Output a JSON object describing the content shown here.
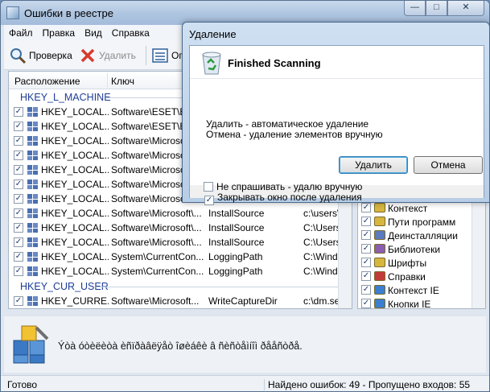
{
  "window": {
    "title": "Ошибки в реестре"
  },
  "menu": [
    "Файл",
    "Правка",
    "Вид",
    "Справка"
  ],
  "toolbar": {
    "check_label": "Проверка",
    "delete_label": "Удалить",
    "options_label": "Оп"
  },
  "list": {
    "columns": [
      "Расположение",
      "Ключ"
    ],
    "group1": "HKEY_L_MACHINE",
    "group2": "HKEY_CUR_USER",
    "rows": [
      {
        "loc": "HKEY_LOCAL...",
        "key": "Software\\ESET\\ESI",
        "val": "",
        "data": ""
      },
      {
        "loc": "HKEY_LOCAL...",
        "key": "Software\\ESET\\ESI",
        "val": "",
        "data": ""
      },
      {
        "loc": "HKEY_LOCAL...",
        "key": "Software\\Microsof",
        "val": "",
        "data": ""
      },
      {
        "loc": "HKEY_LOCAL...",
        "key": "Software\\Microsof",
        "val": "",
        "data": ""
      },
      {
        "loc": "HKEY_LOCAL...",
        "key": "Software\\Microsof",
        "val": "",
        "data": ""
      },
      {
        "loc": "HKEY_LOCAL...",
        "key": "Software\\Microsof",
        "val": "",
        "data": ""
      },
      {
        "loc": "HKEY_LOCAL...",
        "key": "Software\\Microsof",
        "val": "",
        "data": ""
      },
      {
        "loc": "HKEY_LOCAL...",
        "key": "Software\\Microsoft\\...",
        "val": "InstallSource",
        "data": "c:\\users\\"
      },
      {
        "loc": "HKEY_LOCAL...",
        "key": "Software\\Microsoft\\...",
        "val": "InstallSource",
        "data": "C:\\Users"
      },
      {
        "loc": "HKEY_LOCAL...",
        "key": "Software\\Microsoft\\...",
        "val": "InstallSource",
        "data": "C:\\Users"
      },
      {
        "loc": "HKEY_LOCAL...",
        "key": "System\\CurrentCon...",
        "val": "LoggingPath",
        "data": "C:\\Windo"
      },
      {
        "loc": "HKEY_LOCAL...",
        "key": "System\\CurrentCon...",
        "val": "LoggingPath",
        "data": "C:\\Windo"
      }
    ],
    "partial_row": {
      "loc": "HKEY_CURRE...",
      "key": "Software\\Microsoft...",
      "val": "WriteCaptureDir",
      "data": "c:\\dm.se"
    }
  },
  "categories": [
    {
      "label": "Контекст",
      "color": "#d7b640"
    },
    {
      "label": "Пути программ",
      "color": "#d7b640"
    },
    {
      "label": "Деинсталляции",
      "color": "#5a7bbf"
    },
    {
      "label": "Библиотеки",
      "color": "#8a5fb0"
    },
    {
      "label": "Шрифты",
      "color": "#d7b640"
    },
    {
      "label": "Справки",
      "color": "#c23a3a"
    },
    {
      "label": "Контекст IE",
      "color": "#3a7fd0"
    },
    {
      "label": "Кнопки IE",
      "color": "#3a7fd0"
    }
  ],
  "info_message": "Ýòà óòèëèòà èñïðàâëÿåò îøèáêè â ñèñòåìíîì ðååñòðå.",
  "status": {
    "left": "Готово",
    "right": "Найдено ошибок: 49 - Пропущено входов: 55"
  },
  "dialog": {
    "title": "Удаление",
    "heading": "Finished Scanning",
    "line1": "Удалить - автоматическое удаление",
    "line2": "Отмена - удаление элементов вручную",
    "delete_button": "Удалить",
    "cancel_button": "Отмена",
    "opt_close": "Закрывать окно после удаления",
    "opt_noask": "Не спрашивать - удалю вручную"
  }
}
